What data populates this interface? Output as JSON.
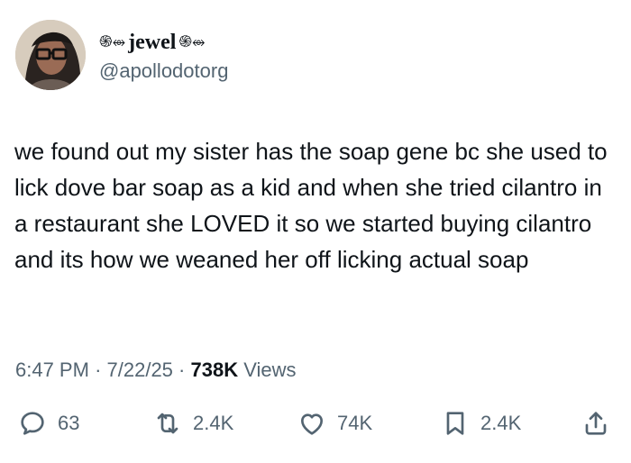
{
  "author": {
    "display_name_prefix": "֍⥈",
    "display_name": "jewel",
    "display_name_suffix": "֍⥈",
    "handle": "@apollodotorg"
  },
  "tweet": {
    "text": "we found out my sister has the soap gene bc she used to lick dove bar soap as a kid and when she tried cilantro in a restaurant she LOVED it so we started buying cilantro and its how we weaned her off licking actual soap"
  },
  "meta": {
    "time": "6:47 PM",
    "separator1": "·",
    "date": "7/22/25",
    "separator2": "·",
    "views_count": "738K",
    "views_label": "Views"
  },
  "actions": {
    "replies": "63",
    "reposts": "2.4K",
    "likes": "74K",
    "bookmarks": "2.4K"
  },
  "icons": {
    "reply": "reply-icon",
    "repost": "repost-icon",
    "like": "heart-icon",
    "bookmark": "bookmark-icon",
    "share": "share-icon"
  }
}
